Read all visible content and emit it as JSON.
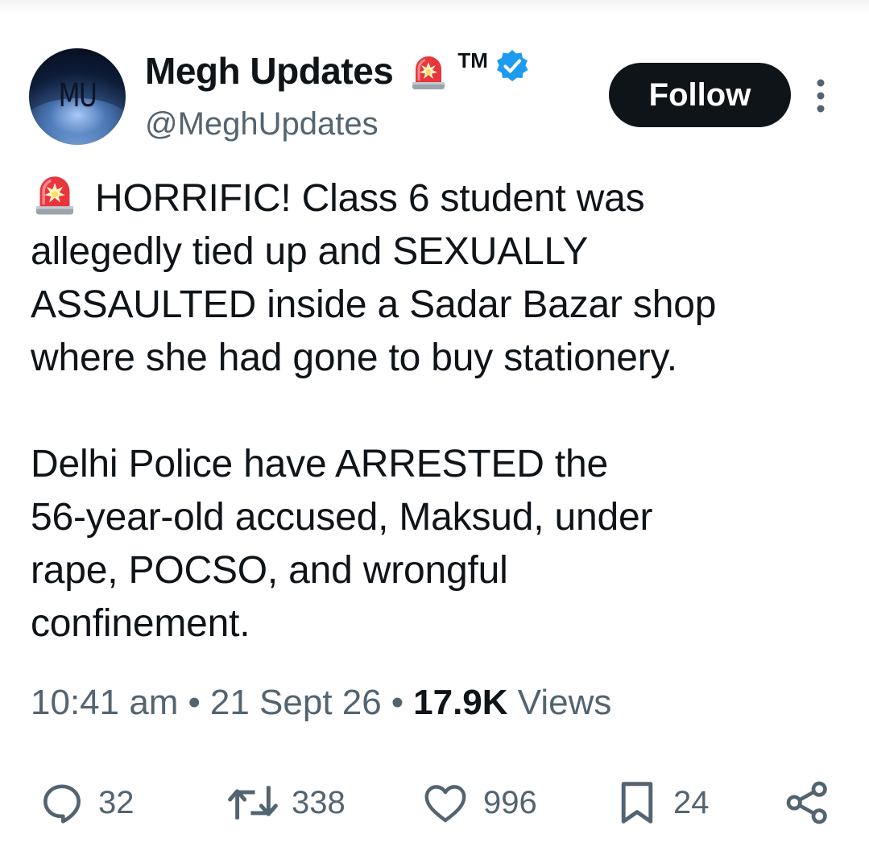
{
  "author": {
    "avatar_text": "MU",
    "display_name": "Megh Updates",
    "tm_mark": "TM",
    "handle": "@MeghUpdates",
    "verified_color": "#1d9bf0"
  },
  "follow_label": "Follow",
  "tweet": {
    "lines": [
      "HORRIFIC! Class 6 student was",
      "allegedly tied up and SEXUALLY",
      "ASSAULTED inside a Sadar Bazar shop",
      "where she had gone to buy stationery."
    ],
    "lines_2": [
      "Delhi Police have ARRESTED the",
      "56-year-old accused, Maksud, under",
      "rape, POCSO, and wrongful",
      "confinement."
    ]
  },
  "meta": {
    "time": "10:41 am",
    "separator": "•",
    "date": "21 Sept 26",
    "views_count": "17.9K",
    "views_label": "Views"
  },
  "actions": {
    "replies": "32",
    "reposts": "338",
    "likes": "996",
    "bookmarks": "24"
  },
  "icons": [
    "siren-icon",
    "verified-icon",
    "more-icon",
    "reply-icon",
    "repost-icon",
    "like-icon",
    "bookmark-icon",
    "share-icon"
  ],
  "colors": {
    "text": "#0f1419",
    "secondary": "#536471",
    "button_bg": "#0f1419",
    "button_text": "#ffffff",
    "siren_red": "#e8363c"
  }
}
